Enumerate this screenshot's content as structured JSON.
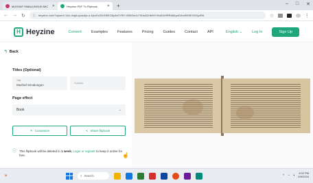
{
  "browser": {
    "tabs": [
      {
        "label": "MUSHAF SIMALUNGUN MIC",
        "active": false,
        "color": "#c23b6b"
      },
      {
        "label": "Heyzine PDF To Flipbook",
        "active": true,
        "color": "#1fa67a"
      }
    ],
    "new_tab": "+",
    "window_controls": [
      "–",
      "□",
      "✕"
    ],
    "url": "heyzine.com/?upsert=1&c=4ajd-cpacb(a-n-4)cxDcZ6rXf8XG8y4vGYBY=EtBGmJc79DsZ&Hb/NYXhsEAHRRsB&ynDAm90HiEX5OyzRA"
  },
  "site": {
    "brand": "Heyzine",
    "nav": [
      "Convert",
      "Examples",
      "Features",
      "Pricing",
      "Guides",
      "Contact",
      "API"
    ],
    "language": "English ⌄",
    "login": "Log In",
    "signup": "Sign Up"
  },
  "panel": {
    "back_label": "Back",
    "titles_heading": "Titles (Optional)",
    "title_field": {
      "label": "Title",
      "value": "Mushaf Simalungun"
    },
    "subtitle_field": {
      "placeholder": "Subtitle"
    },
    "page_effect_heading": "Page effect",
    "page_effect_value": "Book",
    "customize_label": "Customize",
    "share_label": "Share flipbook",
    "notice_pre": "This flipbook will be deleted in",
    "notice_bold": "1 week.",
    "notice_link": "Login or register",
    "notice_post": "to keep it online for free."
  },
  "taskbar": {
    "search": "Search",
    "time": "3:02 PM",
    "date": "6/6/2024"
  }
}
